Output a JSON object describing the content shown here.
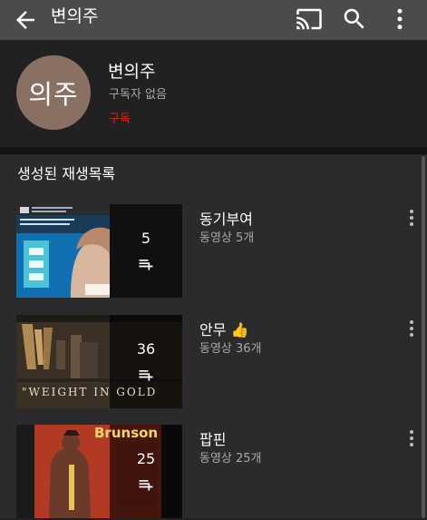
{
  "app_bar": {
    "title": "변의주",
    "icons": [
      "back-arrow-icon",
      "cast-icon",
      "search-icon",
      "more-vert-icon"
    ]
  },
  "channel": {
    "avatar_text": "의주",
    "name": "변의주",
    "subscriber_text": "구독자 없음",
    "subscribe_label": "구독",
    "avatar_color": "#8a6f63",
    "subscribe_color": "#e62117"
  },
  "section": {
    "title": "생성된 재생목록"
  },
  "playlists": [
    {
      "title": "동기부여",
      "meta": "동영상 5개",
      "count": "5",
      "emoji": ""
    },
    {
      "title": "안무",
      "meta": "동영상 36개",
      "count": "36",
      "emoji": "👍"
    },
    {
      "title": "팝핀",
      "meta": "동영상 25개",
      "count": "25",
      "emoji": ""
    }
  ],
  "thumbnail_texts": {
    "p2_banner": "\"WEIGHT IN GOLD",
    "p3_banner": "Brunson"
  },
  "colors": {
    "top_bar": "#4b4b4b",
    "background": "#212121",
    "list_background": "#2b2b2b"
  }
}
